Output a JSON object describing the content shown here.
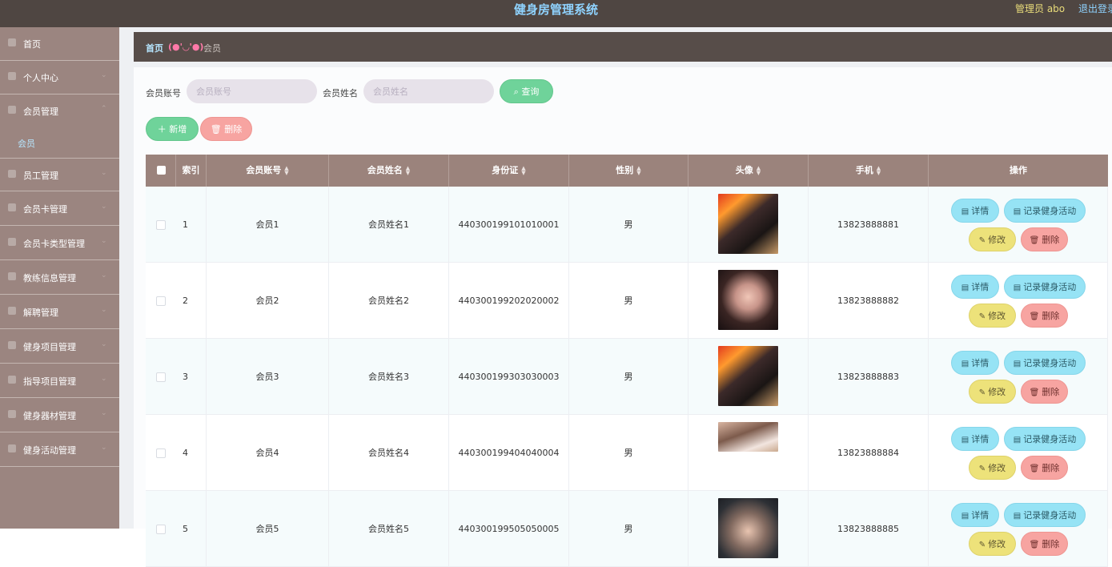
{
  "header": {
    "title": "健身房管理系统",
    "admin_label": "管理员 abo",
    "logout_label": "退出登录"
  },
  "sidebar": {
    "items": [
      {
        "label": "首页",
        "icon": "home-icon"
      },
      {
        "label": "个人中心",
        "icon": "user-icon"
      },
      {
        "label": "会员管理",
        "icon": "flag-icon"
      },
      {
        "label": "员工管理",
        "icon": "list-icon"
      },
      {
        "label": "会员卡管理",
        "icon": "card-icon"
      },
      {
        "label": "会员卡类型管理",
        "icon": "menu-icon"
      },
      {
        "label": "教练信息管理",
        "icon": "circle-icon"
      },
      {
        "label": "解聘管理",
        "icon": "send-icon"
      },
      {
        "label": "健身项目管理",
        "icon": "grid-icon"
      },
      {
        "label": "指导项目管理",
        "icon": "grid-icon"
      },
      {
        "label": "健身器材管理",
        "icon": "person-icon"
      },
      {
        "label": "健身活动管理",
        "icon": "grid-icon"
      }
    ],
    "sub_item": "会员"
  },
  "breadcrumb": {
    "home": "首页",
    "face": "(●'◡'●)",
    "current": "会员"
  },
  "search": {
    "account_label": "会员账号",
    "account_placeholder": "会员账号",
    "name_label": "会员姓名",
    "name_placeholder": "会员姓名",
    "query_label": "查询"
  },
  "toolbar": {
    "add_label": "新增",
    "delete_label": "删除"
  },
  "table": {
    "headers": {
      "index": "索引",
      "account": "会员账号",
      "name": "会员姓名",
      "id_card": "身份证",
      "gender": "性别",
      "avatar": "头像",
      "phone": "手机",
      "actions": "操作"
    },
    "action_labels": {
      "detail": "详情",
      "record": "记录健身活动",
      "edit": "修改",
      "delete": "删除"
    },
    "rows": [
      {
        "index": "1",
        "account": "会员1",
        "name": "会员姓名1",
        "id_card": "440300199101010001",
        "gender": "男",
        "phone": "13823888881"
      },
      {
        "index": "2",
        "account": "会员2",
        "name": "会员姓名2",
        "id_card": "440300199202020002",
        "gender": "男",
        "phone": "13823888882"
      },
      {
        "index": "3",
        "account": "会员3",
        "name": "会员姓名3",
        "id_card": "440300199303030003",
        "gender": "男",
        "phone": "13823888883"
      },
      {
        "index": "4",
        "account": "会员4",
        "name": "会员姓名4",
        "id_card": "440300199404040004",
        "gender": "男",
        "phone": "13823888884"
      },
      {
        "index": "5",
        "account": "会员5",
        "name": "会员姓名5",
        "id_card": "440300199505050005",
        "gender": "男",
        "phone": "13823888885"
      }
    ]
  }
}
